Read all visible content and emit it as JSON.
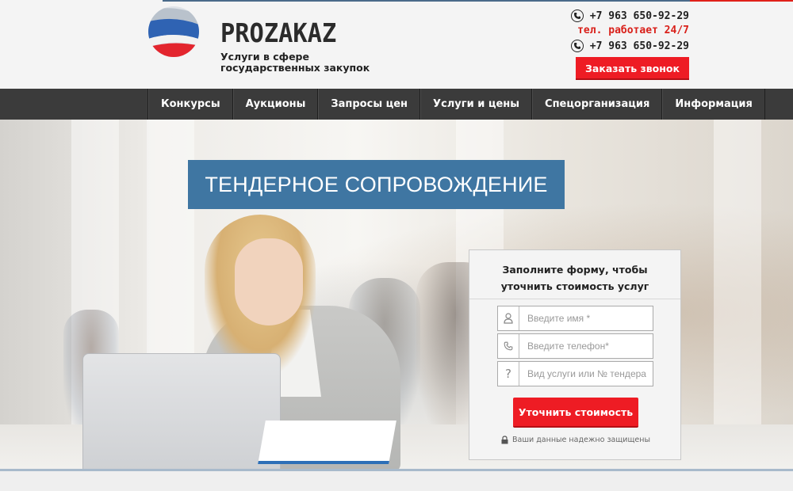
{
  "header": {
    "brand": "PROZAKAZ",
    "tagline_line1": "Услуги в сфере",
    "tagline_line2": "государственных закупок",
    "phone1": "+7 963 650-92-29",
    "work_hours": "тел. работает 24/7",
    "phone2": "+7 963 650-92-29",
    "callback_label": "Заказать звонок"
  },
  "nav": {
    "items": [
      {
        "label": "Конкурсы"
      },
      {
        "label": "Аукционы"
      },
      {
        "label": "Запросы цен"
      },
      {
        "label": "Услуги и цены"
      },
      {
        "label": "Спецорганизация"
      },
      {
        "label": "Информация"
      }
    ]
  },
  "hero": {
    "title": "ТЕНДЕРНОЕ СОПРОВОЖДЕНИЕ"
  },
  "form": {
    "heading_line1": "Заполните форму, чтобы",
    "heading_line2": "уточнить стоимость услуг",
    "name_placeholder": "Введите имя *",
    "phone_placeholder": "Введите телефон*",
    "service_placeholder": "Вид услуги или № тендера",
    "submit_label": "Уточнить стоимость",
    "secure_note": "Ваши данные надежно защищены"
  },
  "colors": {
    "accent_red": "#ee1c24",
    "title_blue": "#3f76a2",
    "nav_bg": "#3b3b3b"
  }
}
